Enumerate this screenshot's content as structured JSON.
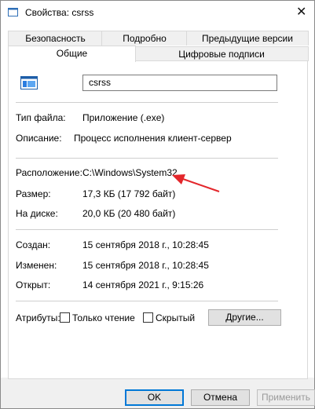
{
  "window": {
    "title": "Свойства: csrss",
    "close_glyph": "✕"
  },
  "tabs": {
    "row1": [
      "Безопасность",
      "Подробно",
      "Предыдущие версии"
    ],
    "row2": [
      "Общие",
      "Цифровые подписи"
    ],
    "active": "Общие"
  },
  "general": {
    "file_name": "csrss",
    "rows": [
      {
        "label": "Тип файла:",
        "value": "Приложение (.exe)"
      },
      {
        "label": "Описание:",
        "value": "Процесс исполнения клиент-сервер"
      },
      {
        "label": "Расположение:",
        "value": "C:\\Windows\\System32"
      },
      {
        "label": "Размер:",
        "value": "17,3 КБ (17 792 байт)"
      },
      {
        "label": "На диске:",
        "value": "20,0 КБ (20 480 байт)"
      },
      {
        "label": "Создан:",
        "value": "15 сентября 2018 г., 10:28:45"
      },
      {
        "label": "Изменен:",
        "value": "15 сентября 2018 г., 10:28:45"
      },
      {
        "label": "Открыт:",
        "value": "14 сентября 2021 г., 9:15:26"
      }
    ],
    "attributes": {
      "label": "Атрибуты:",
      "readonly_label": "Только чтение",
      "readonly_checked": false,
      "hidden_label": "Скрытый",
      "hidden_checked": false,
      "other_button": "Другие..."
    }
  },
  "buttons": {
    "ok": "OK",
    "cancel": "Отмена",
    "apply": "Применить"
  },
  "colors": {
    "accent": "#0078d7",
    "annotation_arrow": "#e3262b"
  },
  "icons": {
    "title": "window-app-icon",
    "file": "application-exe-icon",
    "arrow": "red-annotation-arrow"
  }
}
